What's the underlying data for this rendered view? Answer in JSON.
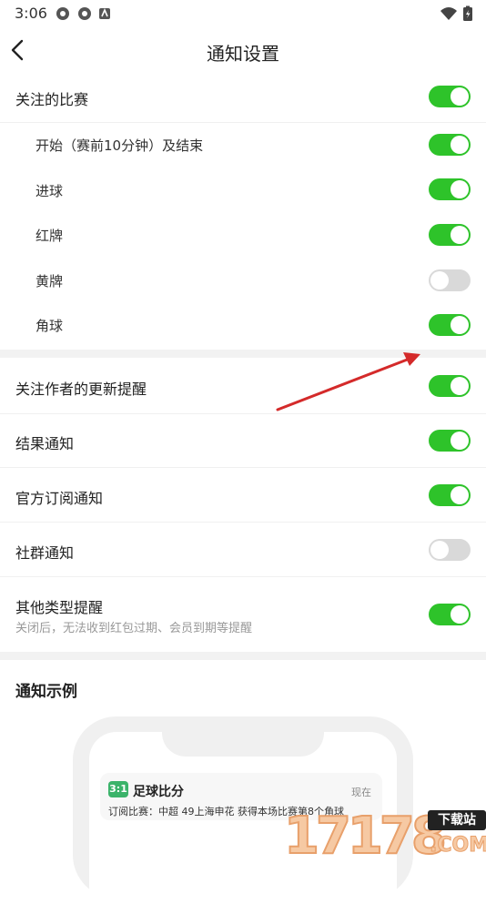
{
  "status_bar": {
    "time": "3:06"
  },
  "header": {
    "title": "通知设置"
  },
  "followed_matches": {
    "label": "关注的比赛",
    "enabled": true,
    "items": [
      {
        "label": "开始（赛前10分钟）及结束",
        "enabled": true
      },
      {
        "label": "进球",
        "enabled": true
      },
      {
        "label": "红牌",
        "enabled": true
      },
      {
        "label": "黄牌",
        "enabled": false
      },
      {
        "label": "角球",
        "enabled": true
      }
    ]
  },
  "settings": [
    {
      "label": "关注作者的更新提醒",
      "enabled": true
    },
    {
      "label": "结果通知",
      "enabled": true
    },
    {
      "label": "官方订阅通知",
      "enabled": true
    },
    {
      "label": "社群通知",
      "enabled": false
    },
    {
      "label": "其他类型提醒",
      "description": "关闭后，无法收到红包过期、会员到期等提醒",
      "enabled": true
    }
  ],
  "example": {
    "title": "通知示例",
    "notification": {
      "app_icon_text": "3:1",
      "app_name": "足球比分",
      "time": "现在",
      "message": "订阅比赛：中超 49上海申花 获得本场比赛第8个角球"
    }
  },
  "watermark": {
    "digits": "17178",
    "badge": "下载站",
    "suffix": ".COM"
  },
  "colors": {
    "toggle_on": "#2ec32a",
    "toggle_off": "#d9d9d9",
    "annotation_arrow": "#d42a2a"
  }
}
